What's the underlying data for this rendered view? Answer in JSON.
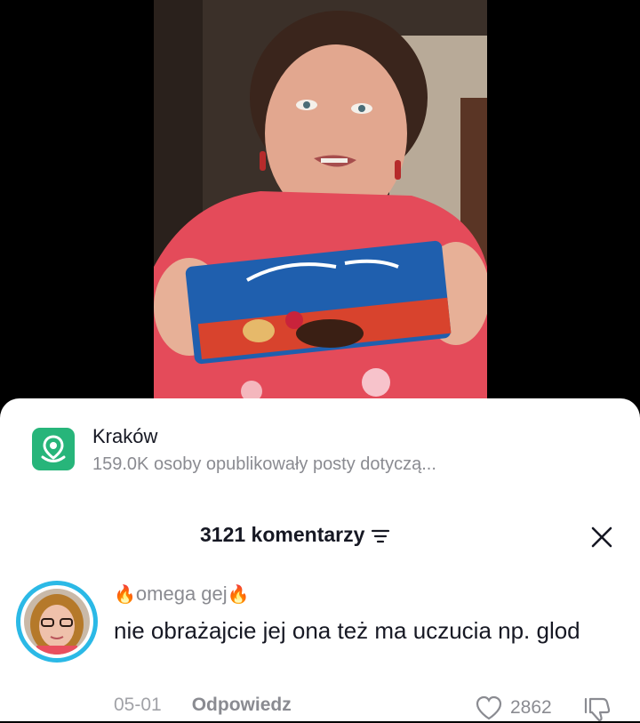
{
  "location": {
    "name": "Kraków",
    "subtitle": "159.0K osoby opublikowały posty dotyczą..."
  },
  "comments_header": {
    "count_label": "3121 komentarzy"
  },
  "comment": {
    "username": "omega gej",
    "text": "nie obrażajcie jej ona też ma uczucia np. glod",
    "date": "05-01",
    "reply_label": "Odpowiedz",
    "likes": "2862"
  },
  "colors": {
    "location_icon_bg": "#27b57a",
    "avatar_ring": "#2bb9e6",
    "text_primary": "#161823",
    "text_secondary": "#8a8b91"
  },
  "icons": [
    "location-pin-icon",
    "sort-icon",
    "close-icon",
    "fire-icon",
    "heart-icon",
    "dislike-icon"
  ]
}
